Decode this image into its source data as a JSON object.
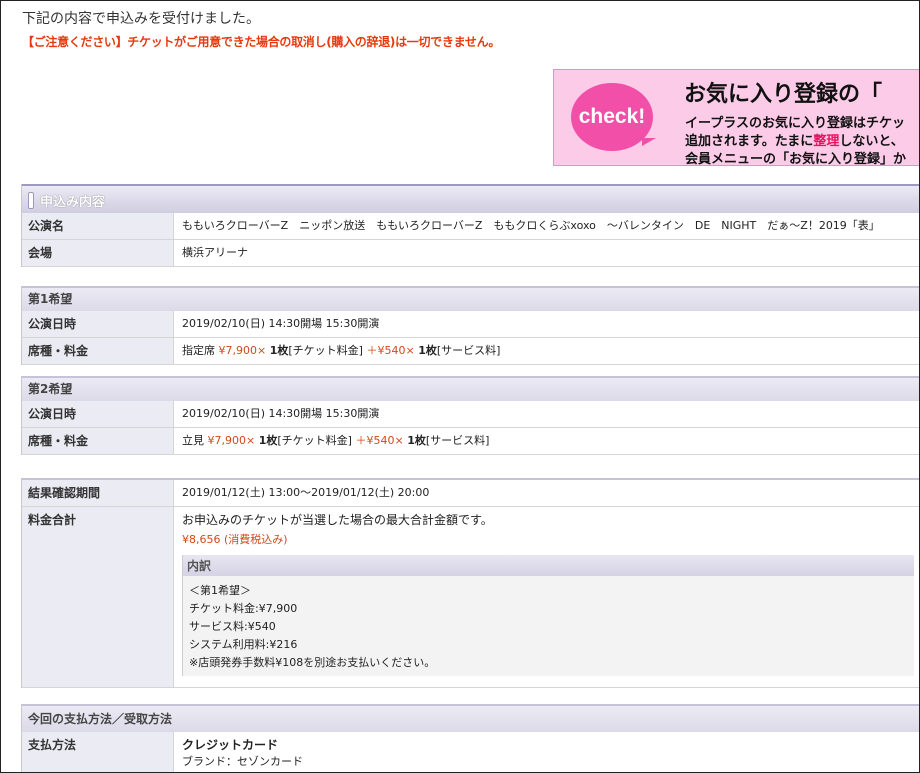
{
  "notice": "下記の内容で申込みを受付けました。",
  "caution": "【ご注意ください】チケットがご用意できた場合の取消し(購入の辞退)は一切できません。",
  "banner": {
    "check": "check!",
    "title": "お気に入り登録の「",
    "line1": "イープラスのお気に入り登録はチケッ",
    "line2a": "追加されます。たまに",
    "line2b": "整理",
    "line2c": "しないと、",
    "line3": "会員メニューの「お気に入り登録」か"
  },
  "application": {
    "title": "申込み内容",
    "rows": [
      {
        "label": "公演名",
        "value": "ももいろクローバーZ　ニッポン放送　ももいろクローバーZ　ももクロくらぶxoxo　～バレンタイン　DE　NIGHT　だぁ～Z！2019「表」"
      },
      {
        "label": "会場",
        "value": "横浜アリーナ"
      }
    ]
  },
  "choice1": {
    "title": "第1希望",
    "date_label": "公演日時",
    "date_value": "2019/02/10(日) 14:30開場 15:30開演",
    "seat_label": "席種・料金",
    "seat_type": "指定席",
    "ticket_price": "¥7,900",
    "times": "×",
    "qty": "1枚",
    "ticket_fee_label": "[チケット料金]",
    "plus": "＋",
    "service_price": "¥540",
    "service_fee_label": "[サービス料]"
  },
  "choice2": {
    "title": "第2希望",
    "date_label": "公演日時",
    "date_value": "2019/02/10(日) 14:30開場 15:30開演",
    "seat_label": "席種・料金",
    "seat_type": "立見",
    "ticket_price": "¥7,900",
    "times": "×",
    "qty": "1枚",
    "ticket_fee_label": "[チケット料金]",
    "plus": "＋",
    "service_price": "¥540",
    "service_fee_label": "[サービス料]"
  },
  "result": {
    "period_label": "結果確認期間",
    "period_value": "2019/01/12(土) 13:00～2019/01/12(土) 20:00",
    "total_label": "料金合計",
    "total_note": "お申込みのチケットが当選した場合の最大合計金額です。",
    "total_amount": "¥8,656",
    "tax_note": "(消費税込み)",
    "breakdown_title": "内訳",
    "breakdown_lines": [
      "＜第1希望＞",
      "チケット料金:¥7,900",
      "サービス料:¥540",
      "システム利用料:¥216",
      "※店頭発券手数料¥108を別途お支払いください。"
    ]
  },
  "payment": {
    "title": "今回の支払方法／受取方法",
    "method_label": "支払方法",
    "method_value": "クレジットカード",
    "brand": "ブランド：セゾンカード"
  }
}
